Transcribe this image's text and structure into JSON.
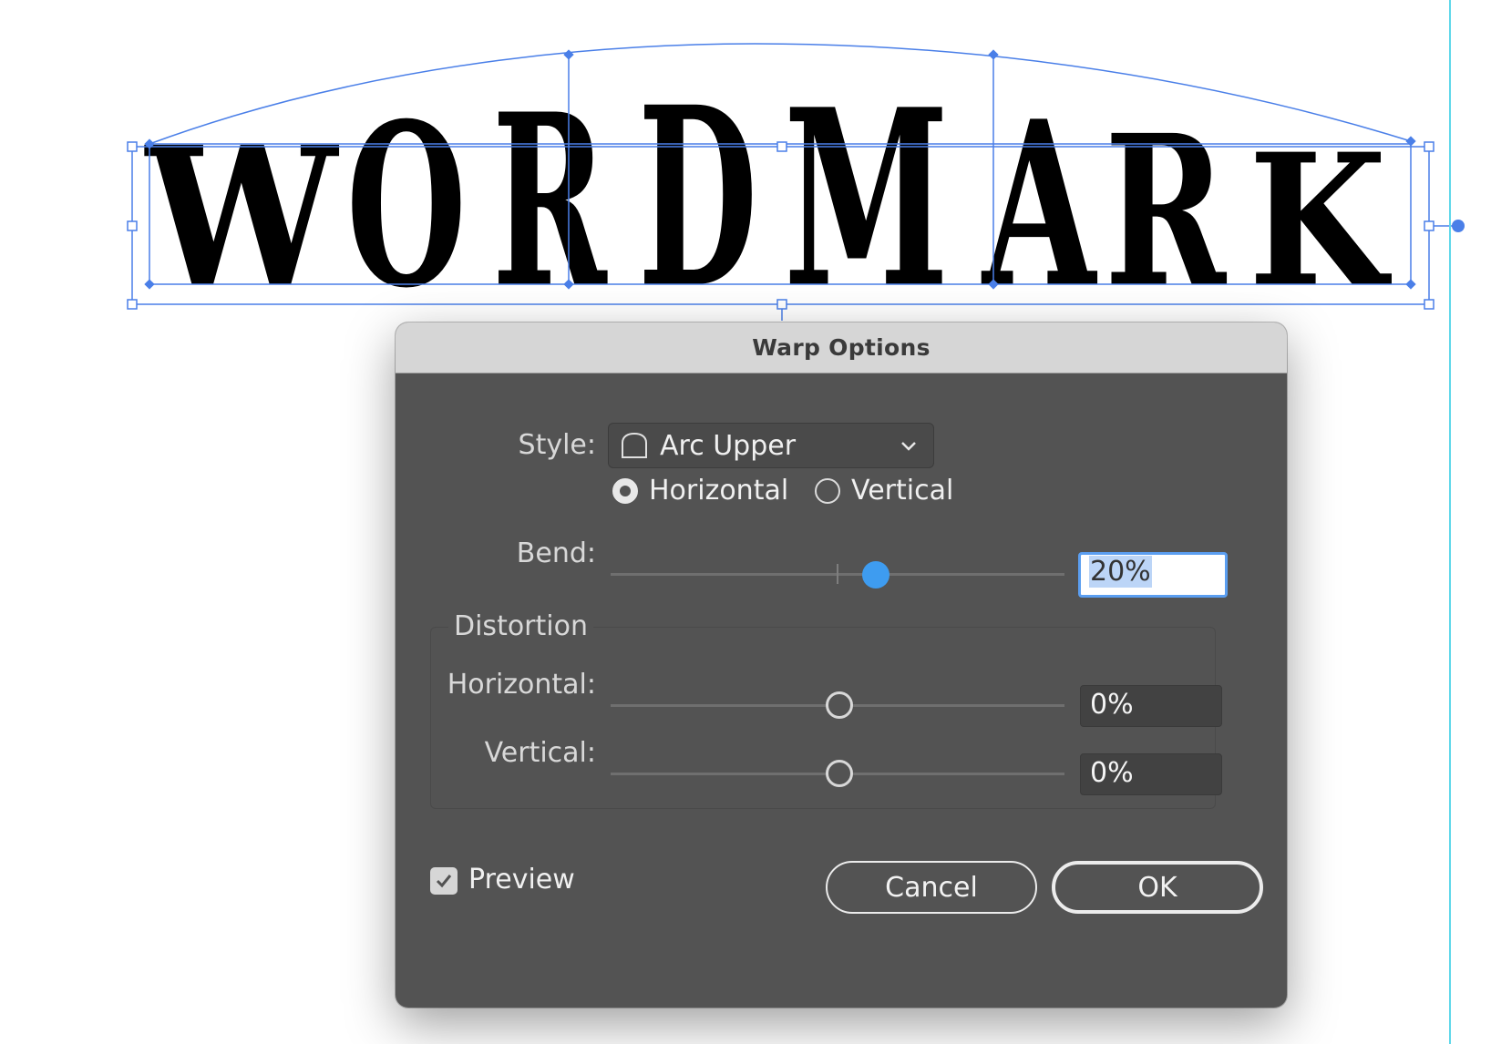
{
  "artwork": {
    "text": "WORDMARK",
    "colors": {
      "selection": "#4a7fe8",
      "guide": "#5fd8ea",
      "glyph": "#000000"
    }
  },
  "dialog": {
    "title": "Warp Options",
    "style": {
      "label": "Style:",
      "value": "Arc Upper",
      "icon": "arc-upper-icon"
    },
    "orientation": {
      "horizontal_label": "Horizontal",
      "vertical_label": "Vertical",
      "selected": "horizontal"
    },
    "bend": {
      "label": "Bend:",
      "value": "20%",
      "level": 20
    },
    "distortion": {
      "legend": "Distortion",
      "horizontal": {
        "label": "Horizontal:",
        "value": "0%",
        "level": 0
      },
      "vertical": {
        "label": "Vertical:",
        "value": "0%",
        "level": 0
      }
    },
    "preview": {
      "label": "Preview",
      "checked": true
    },
    "buttons": {
      "cancel": "Cancel",
      "ok": "OK"
    },
    "colors": {
      "body": "#535353",
      "titlebar": "#d6d6d6",
      "accent": "#3e9cf0"
    }
  }
}
